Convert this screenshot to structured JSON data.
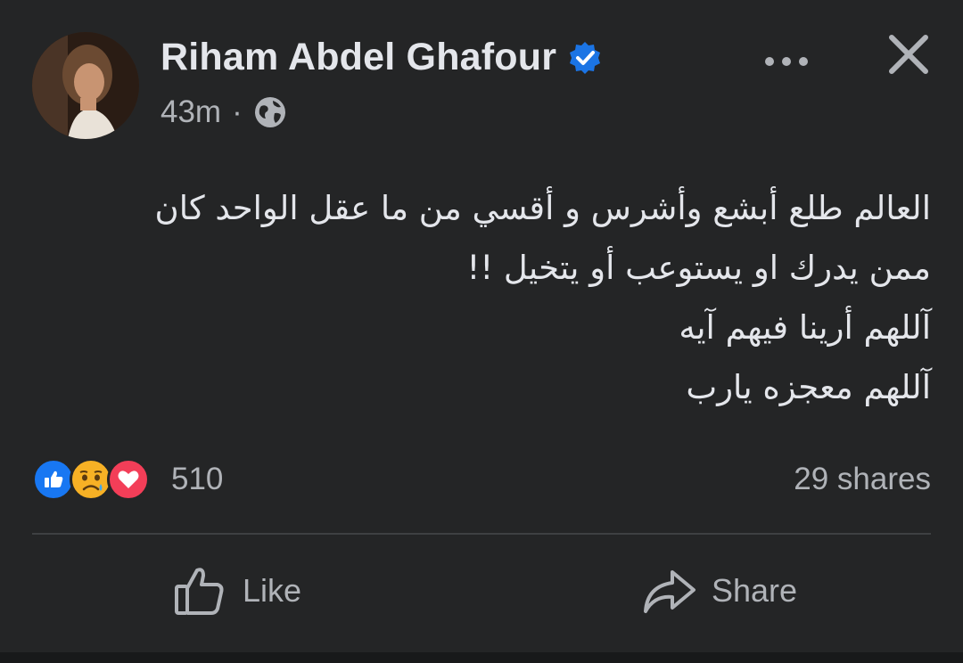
{
  "post": {
    "author": {
      "name": "Riham Abdel Ghafour",
      "verified": true
    },
    "timestamp": "43m",
    "separator": "·",
    "audience_icon": "globe-icon",
    "text_lines": [
      "العالم طلع أبشع وأشرس و أقسي من ما عقل الواحد كان",
      "ممن يدرك او  يستوعب أو يتخيل !!",
      "آللهم أرينا فيهم آيه",
      "آللهم معجزه يارب"
    ],
    "reactions": {
      "types": [
        "like",
        "sad",
        "love"
      ],
      "count": "510"
    },
    "shares": "29 shares",
    "actions": {
      "like_label": "Like",
      "share_label": "Share"
    }
  },
  "colors": {
    "background": "#242526",
    "text_primary": "#e4e6eb",
    "text_secondary": "#b0b3b8",
    "verified_blue": "#1b74e4",
    "like_blue": "#1877f2",
    "love_red": "#f33e58",
    "sad_yellow": "#f7b125"
  }
}
